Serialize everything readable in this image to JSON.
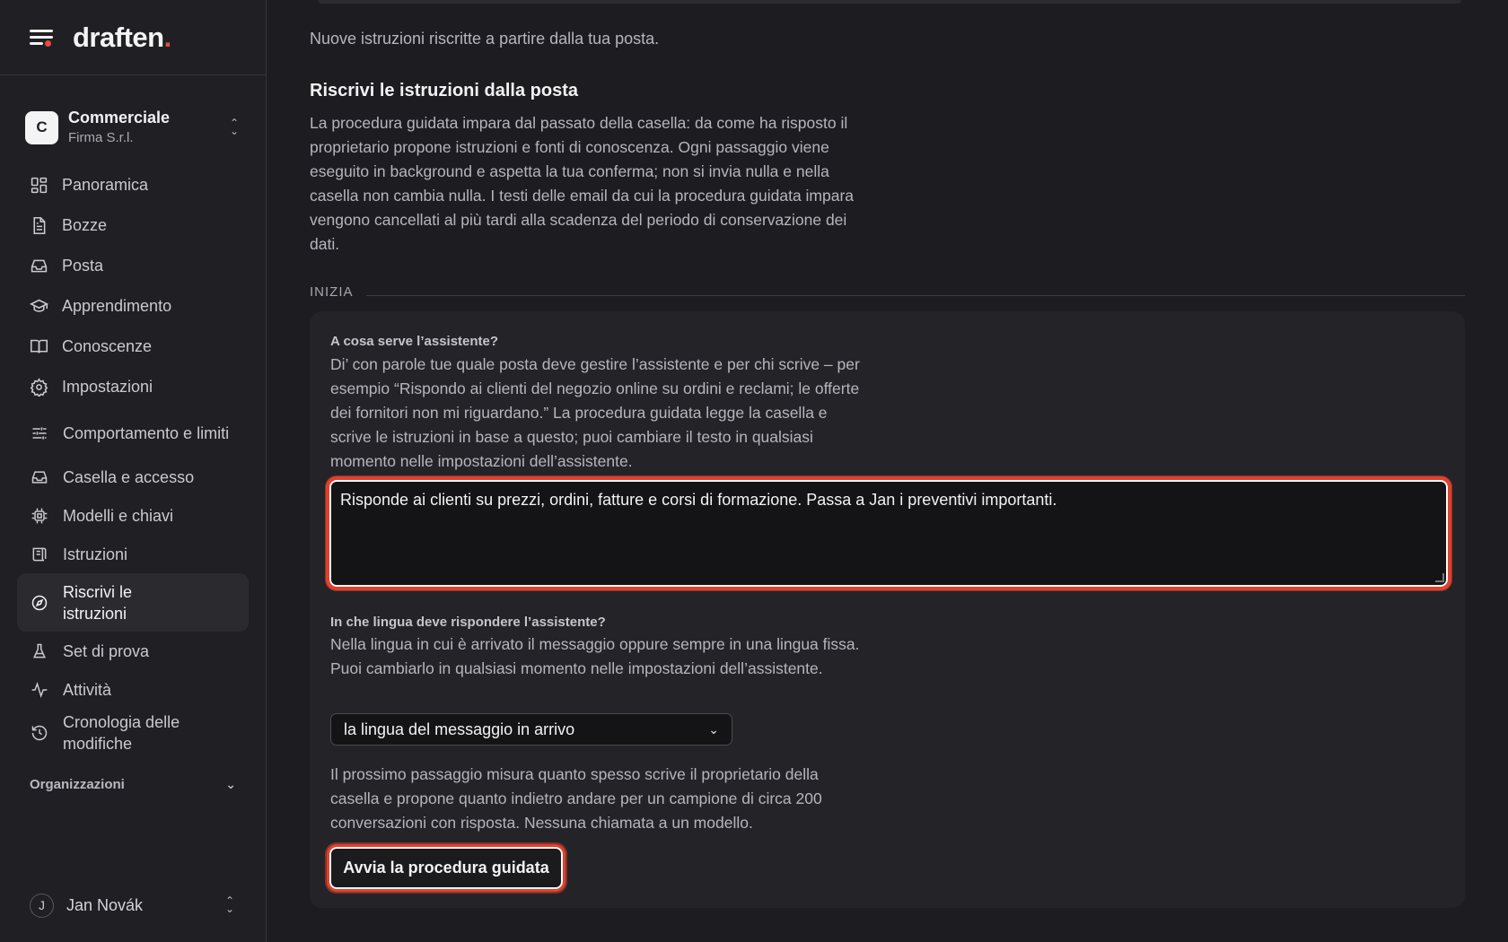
{
  "brand": {
    "logo_text": "draften",
    "logo_dot": ".",
    "accent": "#e94b3c"
  },
  "workspace": {
    "initial": "C",
    "name": "Commerciale",
    "org": "Firma S.r.l."
  },
  "nav": {
    "items": [
      {
        "label": "Panoramica",
        "icon": "dashboard-icon"
      },
      {
        "label": "Bozze",
        "icon": "document-icon"
      },
      {
        "label": "Posta",
        "icon": "inbox-icon"
      },
      {
        "label": "Apprendimento",
        "icon": "graduation-cap-icon"
      },
      {
        "label": "Conoscenze",
        "icon": "book-icon"
      },
      {
        "label": "Impostazioni",
        "icon": "gear-icon"
      }
    ],
    "settings_sub": [
      {
        "label": "Comportamento e limiti",
        "icon": "sliders-icon"
      },
      {
        "label": "Casella e accesso",
        "icon": "inbox-icon"
      },
      {
        "label": "Modelli e chiavi",
        "icon": "chip-icon"
      },
      {
        "label": "Istruzioni",
        "icon": "scroll-icon"
      },
      {
        "label": "Riscrivi le istruzioni",
        "icon": "compass-icon",
        "active": true
      },
      {
        "label": "Set di prova",
        "icon": "flask-icon"
      },
      {
        "label": "Attività",
        "icon": "activity-icon"
      },
      {
        "label": "Cronologia delle modifiche",
        "icon": "history-icon"
      }
    ],
    "organizations_label": "Organizzazioni"
  },
  "user": {
    "initial": "J",
    "name": "Jan Novák"
  },
  "main": {
    "lead": "Nuove istruzioni riscritte a partire dalla tua posta.",
    "title": "Riscrivi le istruzioni dalla posta",
    "description": "La procedura guidata impara dal passato della casella: da come ha risposto il proprietario propone istruzioni e fonti di conoscenza. Ogni passaggio viene eseguito in background e aspetta la tua conferma; non si invia nulla e nella casella non cambia nulla. I testi delle email da cui la procedura guidata impara vengono cancellati al più tardi alla scadenza del periodo di conservazione dei dati.",
    "section_label": "INIZIA",
    "purpose": {
      "label": "A cosa serve l’assistente?",
      "help": "Di’ con parole tue quale posta deve gestire l’assistente e per chi scrive – per esempio “Rispondo ai clienti del negozio online su ordini e reclami; le offerte dei fornitori non mi riguardano.” La procedura guidata legge la casella e scrive le istruzioni in base a questo; puoi cambiare il testo in qualsiasi momento nelle impostazioni dell’assistente.",
      "value": "Risponde ai clienti su prezzi, ordini, fatture e corsi di formazione. Passa a Jan i preventivi importanti."
    },
    "language": {
      "label": "In che lingua deve rispondere l’assistente?",
      "help": "Nella lingua in cui è arrivato il messaggio oppure sempre in una lingua fissa. Puoi cambiarlo in qualsiasi momento nelle impostazioni dell’assistente.",
      "selected": "la lingua del messaggio in arrivo"
    },
    "next_step_note": "Il prossimo passaggio misura quanto spesso scrive il proprietario della casella e propone quanto indietro andare per un campione di circa 200 conversazioni con risposta. Nessuna chiamata a un modello.",
    "start_button": "Avvia la procedura guidata"
  }
}
